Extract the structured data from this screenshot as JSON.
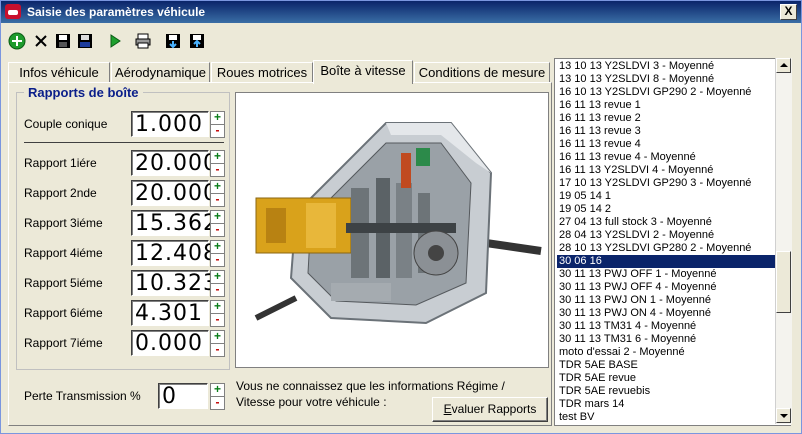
{
  "window": {
    "title": "Saisie des paramètres véhicule",
    "close_label": "X"
  },
  "toolbar": {
    "buttons": [
      {
        "name": "add-icon"
      },
      {
        "name": "delete-icon"
      },
      {
        "name": "save-icon"
      },
      {
        "name": "save-all-icon"
      },
      {
        "name": "run-icon"
      },
      {
        "name": "print-icon"
      },
      {
        "name": "import-icon"
      },
      {
        "name": "export-icon"
      }
    ]
  },
  "tabs": [
    "Infos véhicule",
    "Aérodynamique",
    "Roues motrices",
    "Boîte à vitesse",
    "Conditions de mesure"
  ],
  "active_tab": "Boîte à vitesse",
  "rapports": {
    "group_title": "Rapports de boîte",
    "couple_label": "Couple conique",
    "couple_value": "1.000",
    "rows": [
      {
        "label": "Rapport 1iére",
        "value": "20.000"
      },
      {
        "label": "Rapport 2nde",
        "value": "20.000"
      },
      {
        "label": "Rapport 3iéme",
        "value": "15.362"
      },
      {
        "label": "Rapport 4iéme",
        "value": "12.408"
      },
      {
        "label": "Rapport 5iéme",
        "value": "10.323"
      },
      {
        "label": "Rapport 6iéme",
        "value": "4.301"
      },
      {
        "label": "Rapport 7iéme",
        "value": "0.000"
      }
    ],
    "spin_up": "+",
    "spin_down": "-"
  },
  "perte": {
    "label": "Perte Transmission %",
    "value": "0"
  },
  "info_text": "Vous ne connaissez que les informations Régime / Vitesse pour votre véhicule :",
  "evaluer_button": {
    "prefix": "E",
    "rest": "valuer Rapports"
  },
  "list": {
    "items": [
      "13 10 13 Y2SLDVI 3 - Moyenné",
      "13 10 13 Y2SLDVI 8 - Moyenné",
      "16 10 13 Y2SLDVI GP290 2 - Moyenné",
      "16 11 13 revue 1",
      "16 11 13 revue 2",
      "16 11 13 revue 3",
      "16 11 13 revue 4",
      "16 11 13 revue 4 - Moyenné",
      "16 11 13 Y2SLDVI 4 - Moyenné",
      "17 10 13 Y2SLDVI GP290 3 - Moyenné",
      "19 05 14 1",
      "19 05 14 2",
      "27 04 13 full stock 3 - Moyenné",
      "28 04 13 Y2SLDVI 2 - Moyenné",
      "28 10 13 Y2SLDVI GP280 2 - Moyenné",
      "30 06 16",
      "30 11 13 PWJ OFF 1 - Moyenné",
      "30 11 13 PWJ OFF 4 - Moyenné",
      "30 11 13 PWJ ON 1 - Moyenné",
      "30 11 13 PWJ ON 4 - Moyenné",
      "30 11 13 TM31 4 - Moyenné",
      "30 11 13 TM31 6 - Moyenné",
      "moto d'essai 2 - Moyenné",
      "TDR 5AE BASE",
      "TDR 5AE revue",
      "TDR 5AE revuebis",
      "TDR mars  14",
      "test BV"
    ],
    "selected": "30 06 16"
  },
  "colors": {
    "title_bg": "#0a246a",
    "selection": "#0a246a",
    "group_title": "#0a1e8a",
    "spin_up": "#0b7d1a",
    "spin_down": "#c00000"
  }
}
